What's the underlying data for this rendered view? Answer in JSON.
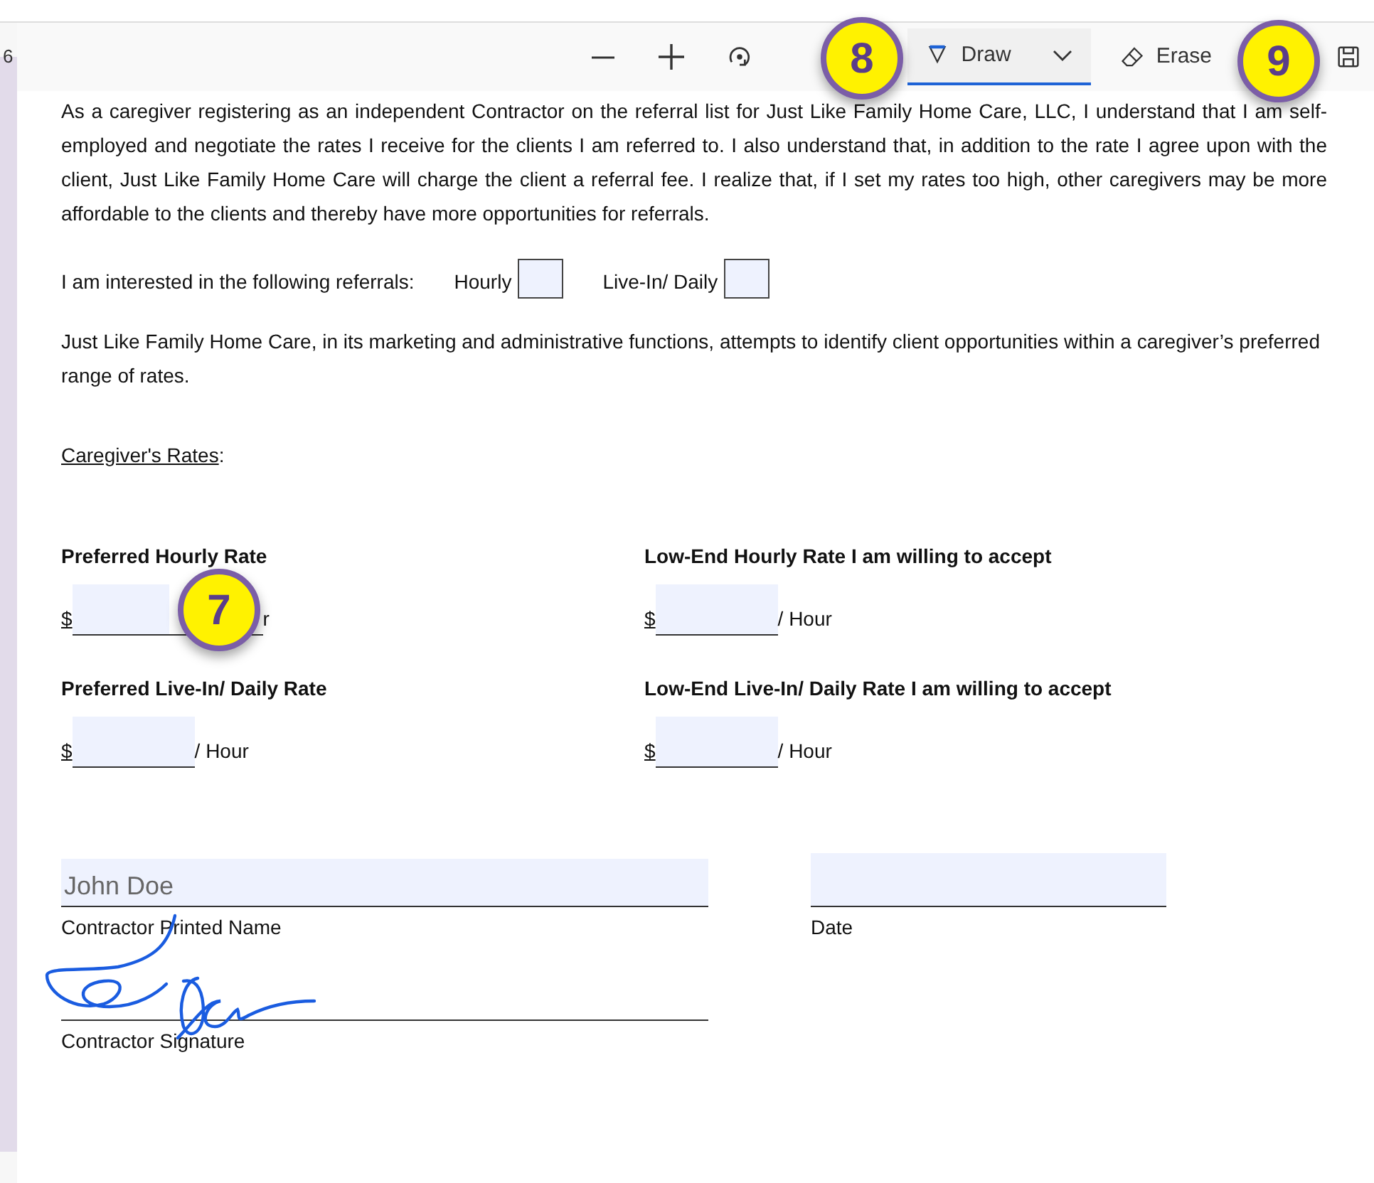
{
  "toolbar": {
    "page_indicator": "6",
    "tools": [
      {
        "kind": "zoom_out"
      },
      {
        "kind": "zoom_in"
      },
      {
        "kind": "rotate"
      },
      {
        "kind": "draw",
        "label": "Draw",
        "selected": true
      },
      {
        "kind": "erase",
        "label": "Erase",
        "selected": false
      },
      {
        "kind": "save"
      }
    ]
  },
  "callouts": [
    {
      "number": "8"
    },
    {
      "number": "9"
    },
    {
      "number": "7"
    }
  ],
  "document": {
    "intro": "As a caregiver registering as an independent Contractor on the referral list for Just Like Family Home Care, LLC, I understand that I am self-employed and negotiate the rates I receive for the clients I am referred to.  I also understand that, in addition to the rate I agree upon with the client, Just Like Family Home Care will charge the client a referral fee.  I realize that, if I set my rates too high, other caregivers may be more affordable to the clients and thereby have more opportunities for referrals.",
    "referrals": {
      "label": "I am interested in the following referrals:",
      "options": [
        {
          "label": "Hourly",
          "checked": false
        },
        {
          "label": "Live-In/ Daily",
          "checked": false
        }
      ]
    },
    "note": "Just Like Family Home Care, in its marketing and administrative functions, attempts to identify client opportunities within a caregiver’s preferred range of rates.",
    "rates_heading": "Caregiver's Rates",
    "rates_heading_suffix": ":",
    "rates": [
      {
        "label": "Preferred Hourly Rate",
        "currency": "$",
        "unit": "r"
      },
      {
        "label": "Low-End Hourly Rate I am willing to accept",
        "currency": "$",
        "unit": "/ Hour"
      },
      {
        "label": "Preferred Live-In/ Daily Rate",
        "currency": "$",
        "unit": "/ Hour"
      },
      {
        "label": "Low-End Live-In/ Daily Rate I am willing to accept",
        "currency": "$",
        "unit": "/ Hour"
      }
    ],
    "printed_name": {
      "value": "John Doe",
      "label": "Contractor Printed Name"
    },
    "date": {
      "label": "Date"
    },
    "signature": {
      "label": "Contractor Signature",
      "signed": true
    }
  }
}
